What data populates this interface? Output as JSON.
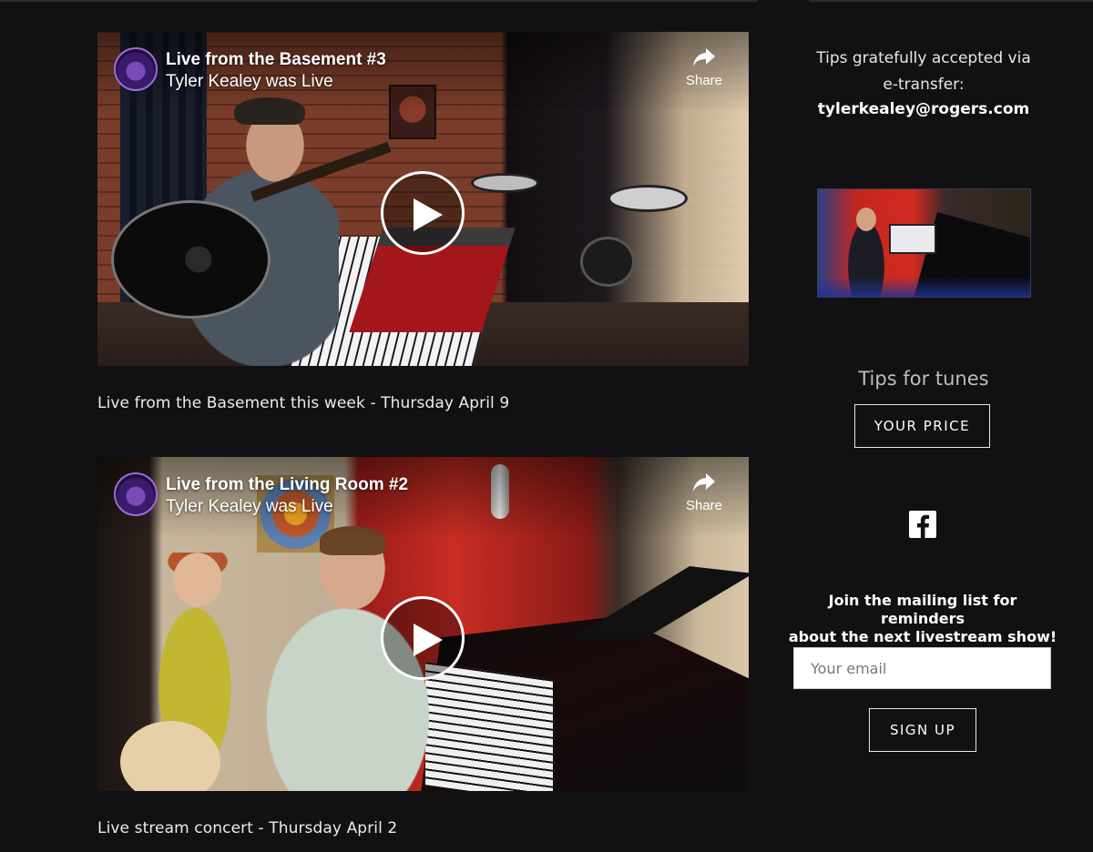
{
  "videos": [
    {
      "title": "Live from the Basement #3",
      "subtitle": "Tyler Kealey was Live",
      "share_label": "Share",
      "caption": "Live from the Basement this week - Thursday April 9"
    },
    {
      "title": "Live from the Living Room #2",
      "subtitle": "Tyler Kealey was Live",
      "share_label": "Share",
      "caption": "Live stream concert - Thursday April 2"
    }
  ],
  "sidebar": {
    "tips_line1": "Tips gratefully accepted via",
    "tips_line2": "e-transfer:",
    "tips_email": "tylerkealey@rogers.com",
    "tips_heading": "Tips for tunes",
    "price_button": "YOUR PRICE",
    "social_icon": "facebook-icon",
    "mailing_heading_line1": "Join the mailing list for reminders",
    "mailing_heading_line2": "about the next livestream show!",
    "email_placeholder": "Your email",
    "signup_button": "SIGN UP"
  },
  "colors": {
    "background": "#111013",
    "text": "#e8e8e8",
    "accent_border": "#e8e8e8"
  }
}
